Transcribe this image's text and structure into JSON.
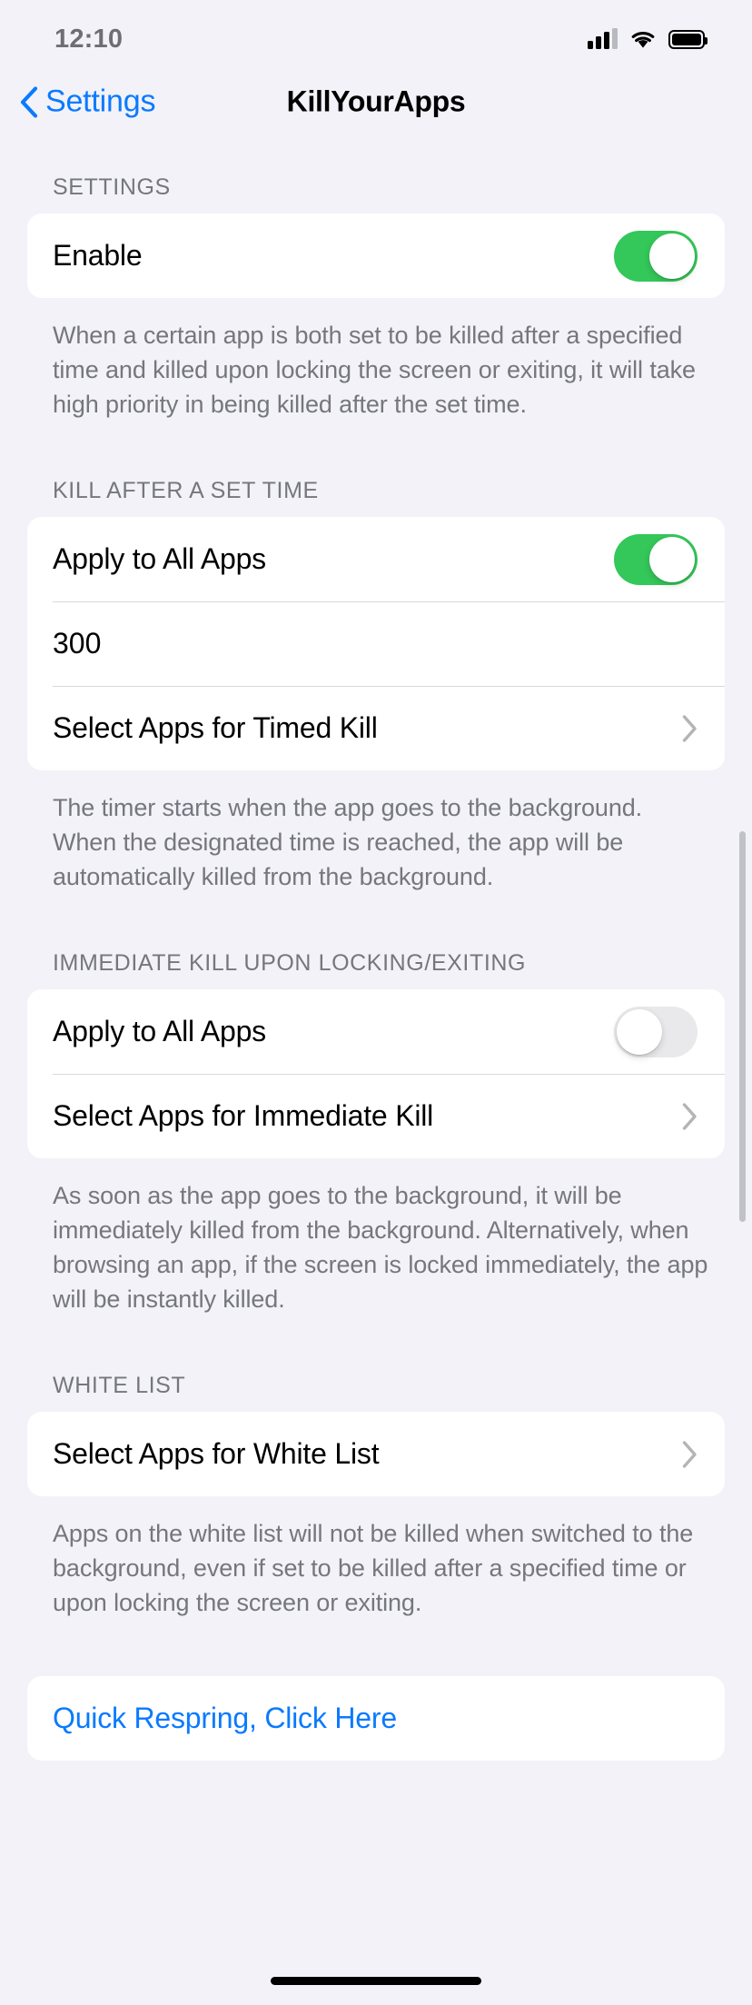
{
  "status_bar": {
    "time": "12:10",
    "cellular_icon": "cellular-signal-icon",
    "wifi_icon": "wifi-icon",
    "battery_icon": "battery-full-icon"
  },
  "nav": {
    "back_label": "Settings",
    "back_icon": "chevron-left-icon",
    "title": "KillYourApps"
  },
  "colors": {
    "accent_blue": "#0A7AFF",
    "switch_on_green": "#34C759",
    "switch_off_gray": "#E9E9EB",
    "page_background": "#F2F2F8",
    "card_background": "#FFFFFF",
    "secondary_text": "#76767E"
  },
  "sections": [
    {
      "header": "SETTINGS",
      "rows": [
        {
          "label": "Enable",
          "control": "switch",
          "value": "on"
        }
      ],
      "footer": "When a certain app is both set to be killed after a specified time and killed upon locking the screen or exiting, it will take high priority in being killed after the set time."
    },
    {
      "header": "KILL AFTER A SET TIME",
      "rows": [
        {
          "label": "Apply to All Apps",
          "control": "switch",
          "value": "on"
        },
        {
          "label": "300",
          "control": "textfield",
          "value": "300",
          "placeholder": "300"
        },
        {
          "label": "Select Apps for Timed Kill",
          "control": "disclosure",
          "icon": "chevron-right-icon"
        }
      ],
      "footer": "The timer starts when the app goes to the background. When the designated time is reached, the app will be automatically killed from the background."
    },
    {
      "header": "IMMEDIATE KILL UPON LOCKING/EXITING",
      "rows": [
        {
          "label": "Apply to All Apps",
          "control": "switch",
          "value": "off"
        },
        {
          "label": "Select Apps for Immediate Kill",
          "control": "disclosure",
          "icon": "chevron-right-icon"
        }
      ],
      "footer": "As soon as the app goes to the background, it will be immediately killed from the background. Alternatively, when browsing an app, if the screen is locked immediately, the app will be instantly killed."
    },
    {
      "header": "WHITE LIST",
      "rows": [
        {
          "label": "Select Apps for White List",
          "control": "disclosure",
          "icon": "chevron-right-icon"
        }
      ],
      "footer": "Apps on the white list will not be killed when switched to the background, even if set to be killed after a specified time or upon locking the screen or exiting."
    },
    {
      "header": "",
      "rows": [
        {
          "label": "Quick Respring, Click Here",
          "control": "link"
        }
      ],
      "footer": ""
    }
  ]
}
